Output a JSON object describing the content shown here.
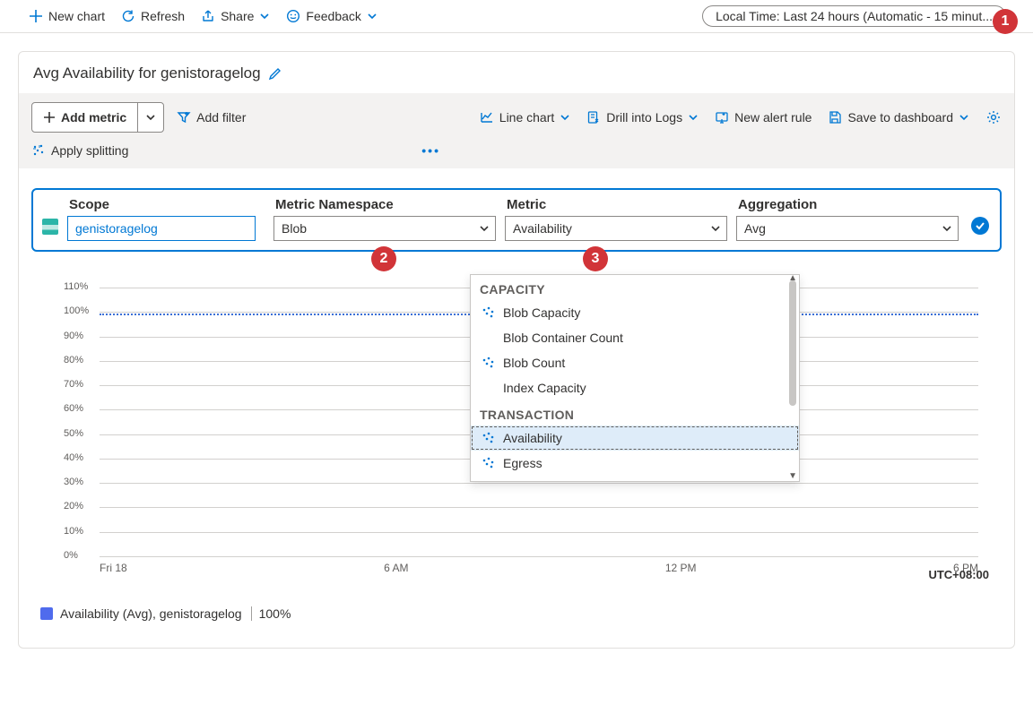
{
  "toolbar": {
    "new_chart": "New chart",
    "refresh": "Refresh",
    "share": "Share",
    "feedback": "Feedback",
    "time_range": "Local Time: Last 24 hours (Automatic - 15 minut..."
  },
  "card": {
    "title": "Avg Availability for genistoragelog"
  },
  "config": {
    "add_metric": "Add metric",
    "add_filter": "Add filter",
    "apply_splitting": "Apply splitting",
    "line_chart": "Line chart",
    "drill_logs": "Drill into Logs",
    "new_alert": "New alert rule",
    "save_dashboard": "Save to dashboard"
  },
  "picker": {
    "scope_label": "Scope",
    "scope_value": "genistoragelog",
    "namespace_label": "Metric Namespace",
    "namespace_value": "Blob",
    "metric_label": "Metric",
    "metric_value": "Availability",
    "aggregation_label": "Aggregation",
    "aggregation_value": "Avg"
  },
  "metric_dropdown": {
    "cat1": "CAPACITY",
    "opt1": "Blob Capacity",
    "opt2": "Blob Container Count",
    "opt3": "Blob Count",
    "opt4": "Index Capacity",
    "cat2": "TRANSACTION",
    "opt5": "Availability",
    "opt6": "Egress"
  },
  "legend": {
    "text": "Availability (Avg), genistoragelog",
    "value": "100%"
  },
  "callouts": {
    "c1": "1",
    "c2": "2",
    "c3": "3"
  },
  "chart_data": {
    "type": "line",
    "title": "Avg Availability for genistoragelog",
    "series": [
      {
        "name": "Availability (Avg), genistoragelog",
        "x": [
          "Fri 18",
          "6 AM",
          "12 PM",
          "6 PM"
        ],
        "values": [
          100,
          100,
          100,
          100
        ]
      }
    ],
    "ylabel": "%",
    "ylim": [
      0,
      110
    ],
    "yticks": [
      "0%",
      "10%",
      "20%",
      "30%",
      "40%",
      "50%",
      "60%",
      "70%",
      "80%",
      "90%",
      "100%",
      "110%"
    ],
    "xticks": [
      "Fri 18",
      "6 AM",
      "12 PM",
      "6 PM"
    ],
    "timezone": "UTC+08:00"
  }
}
